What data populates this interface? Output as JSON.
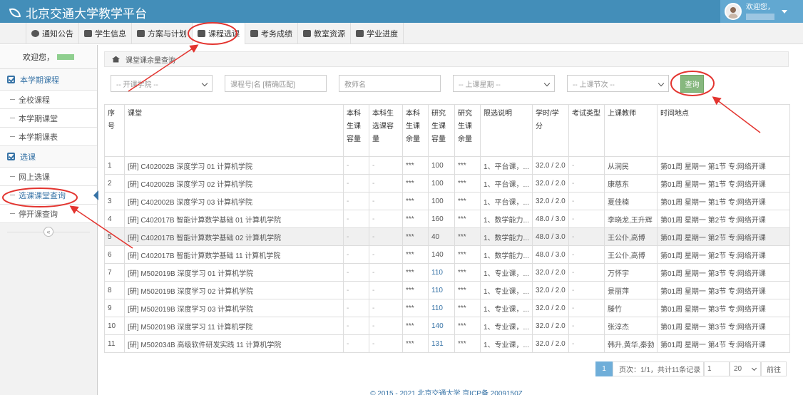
{
  "header": {
    "title": "北京交通大学教学平台",
    "user_greeting": "欢迎您，"
  },
  "nav": {
    "items": [
      {
        "label": "通知公告",
        "icon": "globe-icon"
      },
      {
        "label": "学生信息",
        "icon": "graduation-cap-icon"
      },
      {
        "label": "方案与计划",
        "icon": "plan-icon"
      },
      {
        "label": "课程选课",
        "icon": "calendar-icon"
      },
      {
        "label": "考务成绩",
        "icon": "bar-chart-icon"
      },
      {
        "label": "教室资源",
        "icon": "bank-icon"
      },
      {
        "label": "学业进度",
        "icon": "progress-icon"
      }
    ],
    "active": "课程选课"
  },
  "sidebar": {
    "welcome": "欢迎您，",
    "groups": [
      {
        "title": "本学期课程",
        "items": [
          "全校课程",
          "本学期课堂",
          "本学期课表"
        ]
      },
      {
        "title": "选课",
        "items": [
          "网上选课",
          "选课课堂查询",
          "停开课查询"
        ]
      }
    ],
    "active_item": "选课课堂查询",
    "collapse": "«"
  },
  "breadcrumb": "课堂课余量查询",
  "filters": {
    "college_placeholder": "-- 开课学院 --",
    "course_placeholder": "课程号|名 [精确匹配]",
    "teacher_placeholder": "教师名",
    "weekday_placeholder": "-- 上课星期 --",
    "section_placeholder": "-- 上课节次 --",
    "query_button": "查询"
  },
  "table": {
    "headers": [
      "序号",
      "课堂",
      "本科生课容量",
      "本科生选课容量",
      "本科生课余量",
      "研究生课容量",
      "研究生课余量",
      "限选说明",
      "学时/学分",
      "考试类型",
      "上课教师",
      "时间地点"
    ],
    "rows": [
      [
        "1",
        "[研] C402002B 深度学习 01 计算机学院",
        "-",
        "-",
        "***",
        "100",
        "***",
        "1、平台课，...",
        "32.0 / 2.0",
        "-",
        "从润民",
        "第01周 星期一 第1节 专:网络开课"
      ],
      [
        "2",
        "[研] C402002B 深度学习 02 计算机学院",
        "-",
        "-",
        "***",
        "100",
        "***",
        "1、平台课，...",
        "32.0 / 2.0",
        "-",
        "康慈东",
        "第01周 星期一 第1节 专:网络开课"
      ],
      [
        "3",
        "[研] C402002B 深度学习 03 计算机学院",
        "-",
        "-",
        "***",
        "100",
        "***",
        "1、平台课，...",
        "32.0 / 2.0",
        "-",
        "夏佳楠",
        "第01周 星期一 第1节 专:网络开课"
      ],
      [
        "4",
        "[研] C402017B 智能计算数学基础 01 计算机学院",
        "-",
        "-",
        "***",
        "160",
        "***",
        "1、数学能力...",
        "48.0 / 3.0",
        "-",
        "李晓龙,王升辉",
        "第01周 星期一 第2节 专:网络开课"
      ],
      [
        "5",
        "[研] C402017B 智能计算数学基础 02 计算机学院",
        "-",
        "-",
        "***",
        "40",
        "***",
        "1、数学能力...",
        "48.0 / 3.0",
        "-",
        "王公仆,高博",
        "第01周 星期一 第2节 专:网络开课"
      ],
      [
        "6",
        "[研] C402017B 智能计算数学基础 11 计算机学院",
        "-",
        "-",
        "***",
        "140",
        "***",
        "1、数学能力...",
        "48.0 / 3.0",
        "-",
        "王公仆,高博",
        "第01周 星期一 第2节 专:网络开课"
      ],
      [
        "7",
        "[研] M502019B 深度学习 01 计算机学院",
        "-",
        "-",
        "***",
        "110",
        "***",
        "1、专业课，...",
        "32.0 / 2.0",
        "-",
        "万怀宇",
        "第01周 星期一 第3节 专:网络开课"
      ],
      [
        "8",
        "[研] M502019B 深度学习 02 计算机学院",
        "-",
        "-",
        "***",
        "110",
        "***",
        "1、专业课，...",
        "32.0 / 2.0",
        "-",
        "景丽萍",
        "第01周 星期一 第3节 专:网络开课"
      ],
      [
        "9",
        "[研] M502019B 深度学习 03 计算机学院",
        "-",
        "-",
        "***",
        "110",
        "***",
        "1、专业课，...",
        "32.0 / 2.0",
        "-",
        "滕竹",
        "第01周 星期一 第3节 专:网络开课"
      ],
      [
        "10",
        "[研] M502019B 深度学习 11 计算机学院",
        "-",
        "-",
        "***",
        "140",
        "***",
        "1、专业课，...",
        "32.0 / 2.0",
        "-",
        "张淳杰",
        "第01周 星期一 第3节 专:网络开课"
      ],
      [
        "11",
        "[研] M502034B 高级软件研发实践 11 计算机学院",
        "-",
        "-",
        "***",
        "131",
        "***",
        "1、专业课，...",
        "32.0 / 2.0",
        "-",
        "韩升,黄华,秦勃",
        "第01周 星期一 第4节 专:网络开课"
      ]
    ]
  },
  "pagination": {
    "current": "1",
    "info": "页次：1/1，共计11条记录",
    "page_input": "1",
    "page_size": "20",
    "prev": "前往"
  },
  "footer": "© 2015 - 2021 北京交通大学 京ICP备 2009150Z",
  "colors": {
    "topbar": "#438eb9",
    "accent": "#3773a6",
    "query_button": "#87b87f",
    "annotation": "#e3342f"
  }
}
